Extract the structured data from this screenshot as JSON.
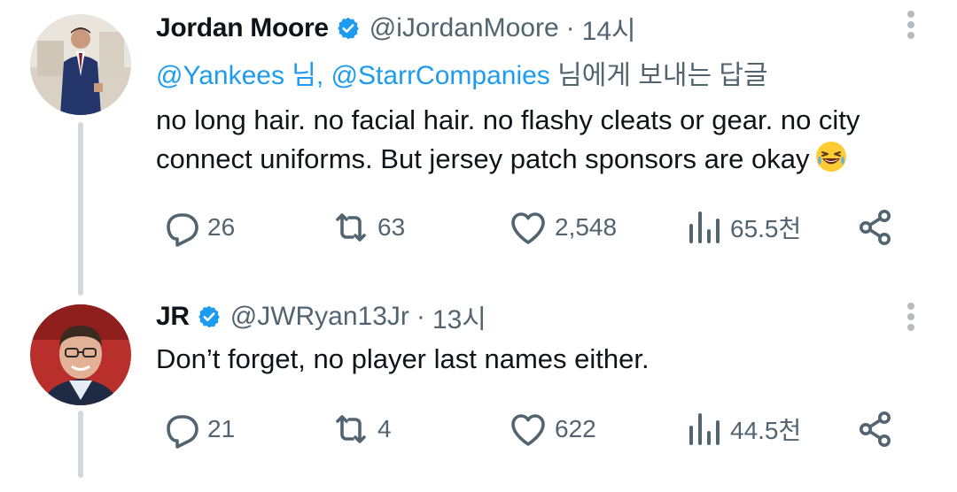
{
  "tweets": [
    {
      "author_name": "Jordan Moore",
      "handle": "@iJordanMoore",
      "separator": "·",
      "time": "14시",
      "replying_to": {
        "mention1": "@Yankees 님,",
        "mention2": "@StarrCompanies",
        "suffix": " 님에게 보내는 답글"
      },
      "text_line1": "no long hair. no facial hair. no flashy cleats or gear. no city",
      "text_line2": "connect uniforms. But jersey patch sponsors are okay",
      "emoji_icon": "laughing-face-emoji",
      "counts": {
        "replies": "26",
        "retweets": "63",
        "likes": "2,548",
        "views": "65.5천"
      }
    },
    {
      "author_name": "JR",
      "handle": "@JWRyan13Jr",
      "separator": "·",
      "time": "13시",
      "text_line1": "Don’t forget, no player last names either.",
      "counts": {
        "replies": "21",
        "retweets": "4",
        "likes": "622",
        "views": "44.5천"
      }
    }
  ],
  "colors": {
    "link": "#1d9bf0",
    "secondary_text": "#536471",
    "verified_badge": "#1d9bf0",
    "thread_line": "#cfd9de"
  },
  "icons": [
    "reply-icon",
    "retweet-icon",
    "like-icon",
    "views-icon",
    "share-icon",
    "verified-icon",
    "more-options-icon"
  ]
}
